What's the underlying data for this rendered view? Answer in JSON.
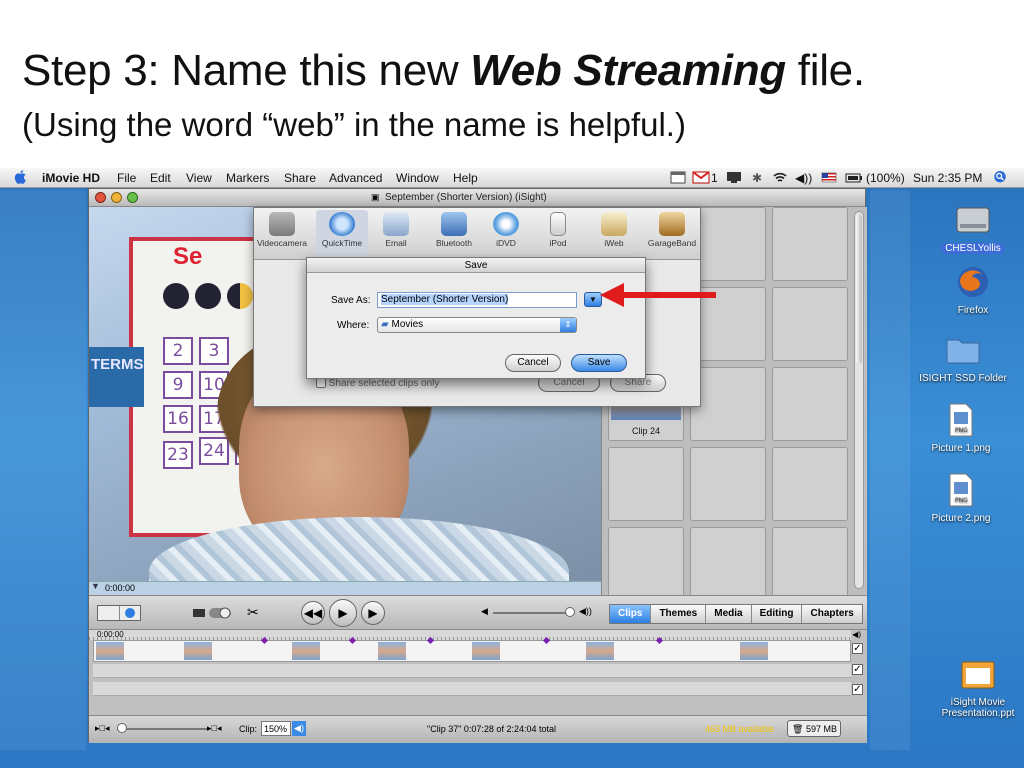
{
  "slide": {
    "title_prefix": "Step 3: Name this new ",
    "title_emphasis": "Web Streaming",
    "title_suffix": " file.",
    "subtitle": "(Using the word “web” in the name is helpful.)"
  },
  "menubar": {
    "app_name": "iMovie HD",
    "menus": [
      "File",
      "Edit",
      "View",
      "Markers",
      "Share",
      "Advanced",
      "Window",
      "Help"
    ],
    "status_battery": "(100%)",
    "status_clock": "Sun 2:35 PM",
    "status_gmail_count": "1"
  },
  "desktop": {
    "icons": [
      {
        "label": "CHESLYollis",
        "icon": "hard-drive-icon",
        "selected": true
      },
      {
        "label": "Firefox",
        "icon": "firefox-icon",
        "selected": false
      },
      {
        "label": "ISIGHT SSD Folder",
        "icon": "folder-icon",
        "selected": false
      },
      {
        "label": "Picture 1.png",
        "icon": "png-file-icon",
        "selected": false
      },
      {
        "label": "Picture 2.png",
        "icon": "png-file-icon",
        "selected": false
      },
      {
        "label": "iSight Movie Presentation.ppt",
        "icon": "ppt-file-icon",
        "selected": false
      }
    ]
  },
  "imovie": {
    "window_title": "September (Shorter Version) (iSight)",
    "viewer": {
      "numbers": [
        "2",
        "3",
        "9",
        "10",
        "16",
        "17",
        "23",
        "24",
        "25"
      ],
      "terms_text": "TERMS",
      "logo_text": "Se"
    },
    "scrubber_time": "0:00:00",
    "clip_label": "Clip 24",
    "pane_tabs": [
      "Clips",
      "Themes",
      "Media",
      "Editing",
      "Chapters"
    ],
    "active_pane_tab": "Clips",
    "timeline_time": "0:00:00",
    "status": {
      "clip_label": "Clip:",
      "zoom_value": "150%",
      "clip_info": "\"Clip 37\"  0:07:28 of 2:24:04 total",
      "disk_available": "463 MB available",
      "trash_size": "597 MB"
    }
  },
  "share_sheet": {
    "tools": [
      "Videocamera",
      "QuickTime",
      "Email",
      "Bluetooth",
      "iDVD",
      "iPod",
      "iWeb",
      "GarageBand"
    ],
    "active_tool": "QuickTime",
    "checkbox_label": "Share selected clips only",
    "cancel_label": "Cancel",
    "share_label": "Share"
  },
  "save_dialog": {
    "title": "Save",
    "save_as_label": "Save As:",
    "save_as_value": "September (Shorter Version)",
    "where_label": "Where:",
    "where_value": "Movies",
    "cancel_label": "Cancel",
    "save_label": "Save"
  },
  "colors": {
    "annotation_arrow": "#e01b1b",
    "desktop_blue": "#2f7fca",
    "aqua_blue": "#3b8ae6"
  }
}
